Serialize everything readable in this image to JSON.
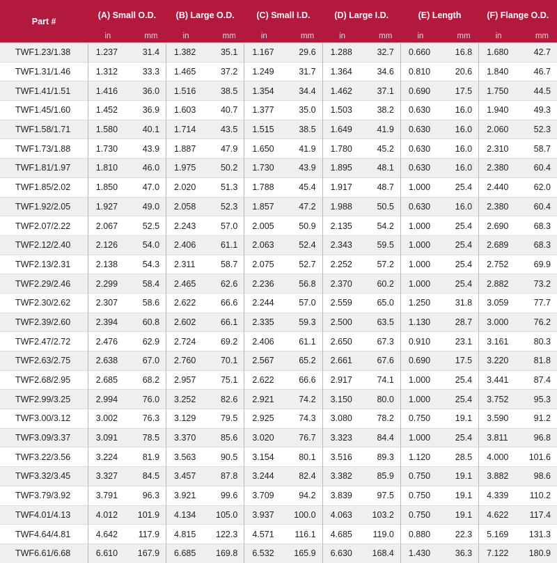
{
  "headers": [
    "Part #",
    "(A) Small O.D.",
    "(B) Large O.D.",
    "(C) Small I.D.",
    "(D) Large I.D.",
    "(E) Length",
    "(F) Flange O.D."
  ],
  "units": [
    "in",
    "mm"
  ],
  "rows": [
    [
      "TWF1.23/1.38",
      "1.237",
      "31.4",
      "1.382",
      "35.1",
      "1.167",
      "29.6",
      "1.288",
      "32.7",
      "0.660",
      "16.8",
      "1.680",
      "42.7"
    ],
    [
      "TWF1.31/1.46",
      "1.312",
      "33.3",
      "1.465",
      "37.2",
      "1.249",
      "31.7",
      "1.364",
      "34.6",
      "0.810",
      "20.6",
      "1.840",
      "46.7"
    ],
    [
      "TWF1.41/1.51",
      "1.416",
      "36.0",
      "1.516",
      "38.5",
      "1.354",
      "34.4",
      "1.462",
      "37.1",
      "0.690",
      "17.5",
      "1.750",
      "44.5"
    ],
    [
      "TWF1.45/1.60",
      "1.452",
      "36.9",
      "1.603",
      "40.7",
      "1.377",
      "35.0",
      "1.503",
      "38.2",
      "0.630",
      "16.0",
      "1.940",
      "49.3"
    ],
    [
      "TWF1.58/1.71",
      "1.580",
      "40.1",
      "1.714",
      "43.5",
      "1.515",
      "38.5",
      "1.649",
      "41.9",
      "0.630",
      "16.0",
      "2.060",
      "52.3"
    ],
    [
      "TWF1.73/1.88",
      "1.730",
      "43.9",
      "1.887",
      "47.9",
      "1.650",
      "41.9",
      "1.780",
      "45.2",
      "0.630",
      "16.0",
      "2.310",
      "58.7"
    ],
    [
      "TWF1.81/1.97",
      "1.810",
      "46.0",
      "1.975",
      "50.2",
      "1.730",
      "43.9",
      "1.895",
      "48.1",
      "0.630",
      "16.0",
      "2.380",
      "60.4"
    ],
    [
      "TWF1.85/2.02",
      "1.850",
      "47.0",
      "2.020",
      "51.3",
      "1.788",
      "45.4",
      "1.917",
      "48.7",
      "1.000",
      "25.4",
      "2.440",
      "62.0"
    ],
    [
      "TWF1.92/2.05",
      "1.927",
      "49.0",
      "2.058",
      "52.3",
      "1.857",
      "47.2",
      "1.988",
      "50.5",
      "0.630",
      "16.0",
      "2.380",
      "60.4"
    ],
    [
      "TWF2.07/2.22",
      "2.067",
      "52.5",
      "2.243",
      "57.0",
      "2.005",
      "50.9",
      "2.135",
      "54.2",
      "1.000",
      "25.4",
      "2.690",
      "68.3"
    ],
    [
      "TWF2.12/2.40",
      "2.126",
      "54.0",
      "2.406",
      "61.1",
      "2.063",
      "52.4",
      "2.343",
      "59.5",
      "1.000",
      "25.4",
      "2.689",
      "68.3"
    ],
    [
      "TWF2.13/2.31",
      "2.138",
      "54.3",
      "2.311",
      "58.7",
      "2.075",
      "52.7",
      "2.252",
      "57.2",
      "1.000",
      "25.4",
      "2.752",
      "69.9"
    ],
    [
      "TWF2.29/2.46",
      "2.299",
      "58.4",
      "2.465",
      "62.6",
      "2.236",
      "56.8",
      "2.370",
      "60.2",
      "1.000",
      "25.4",
      "2.882",
      "73.2"
    ],
    [
      "TWF2.30/2.62",
      "2.307",
      "58.6",
      "2.622",
      "66.6",
      "2.244",
      "57.0",
      "2.559",
      "65.0",
      "1.250",
      "31.8",
      "3.059",
      "77.7"
    ],
    [
      "TWF2.39/2.60",
      "2.394",
      "60.8",
      "2.602",
      "66.1",
      "2.335",
      "59.3",
      "2.500",
      "63.5",
      "1.130",
      "28.7",
      "3.000",
      "76.2"
    ],
    [
      "TWF2.47/2.72",
      "2.476",
      "62.9",
      "2.724",
      "69.2",
      "2.406",
      "61.1",
      "2.650",
      "67.3",
      "0.910",
      "23.1",
      "3.161",
      "80.3"
    ],
    [
      "TWF2.63/2.75",
      "2.638",
      "67.0",
      "2.760",
      "70.1",
      "2.567",
      "65.2",
      "2.661",
      "67.6",
      "0.690",
      "17.5",
      "3.220",
      "81.8"
    ],
    [
      "TWF2.68/2.95",
      "2.685",
      "68.2",
      "2.957",
      "75.1",
      "2.622",
      "66.6",
      "2.917",
      "74.1",
      "1.000",
      "25.4",
      "3.441",
      "87.4"
    ],
    [
      "TWF2.99/3.25",
      "2.994",
      "76.0",
      "3.252",
      "82.6",
      "2.921",
      "74.2",
      "3.150",
      "80.0",
      "1.000",
      "25.4",
      "3.752",
      "95.3"
    ],
    [
      "TWF3.00/3.12",
      "3.002",
      "76.3",
      "3.129",
      "79.5",
      "2.925",
      "74.3",
      "3.080",
      "78.2",
      "0.750",
      "19.1",
      "3.590",
      "91.2"
    ],
    [
      "TWF3.09/3.37",
      "3.091",
      "78.5",
      "3.370",
      "85.6",
      "3.020",
      "76.7",
      "3.323",
      "84.4",
      "1.000",
      "25.4",
      "3.811",
      "96.8"
    ],
    [
      "TWF3.22/3.56",
      "3.224",
      "81.9",
      "3.563",
      "90.5",
      "3.154",
      "80.1",
      "3.516",
      "89.3",
      "1.120",
      "28.5",
      "4.000",
      "101.6"
    ],
    [
      "TWF3.32/3.45",
      "3.327",
      "84.5",
      "3.457",
      "87.8",
      "3.244",
      "82.4",
      "3.382",
      "85.9",
      "0.750",
      "19.1",
      "3.882",
      "98.6"
    ],
    [
      "TWF3.79/3.92",
      "3.791",
      "96.3",
      "3.921",
      "99.6",
      "3.709",
      "94.2",
      "3.839",
      "97.5",
      "0.750",
      "19.1",
      "4.339",
      "110.2"
    ],
    [
      "TWF4.01/4.13",
      "4.012",
      "101.9",
      "4.134",
      "105.0",
      "3.937",
      "100.0",
      "4.063",
      "103.2",
      "0.750",
      "19.1",
      "4.622",
      "117.4"
    ],
    [
      "TWF4.64/4.81",
      "4.642",
      "117.9",
      "4.815",
      "122.3",
      "4.571",
      "116.1",
      "4.685",
      "119.0",
      "0.880",
      "22.3",
      "5.169",
      "131.3"
    ],
    [
      "TWF6.61/6.68",
      "6.610",
      "167.9",
      "6.685",
      "169.8",
      "6.532",
      "165.9",
      "6.630",
      "168.4",
      "1.430",
      "36.3",
      "7.122",
      "180.9"
    ]
  ]
}
